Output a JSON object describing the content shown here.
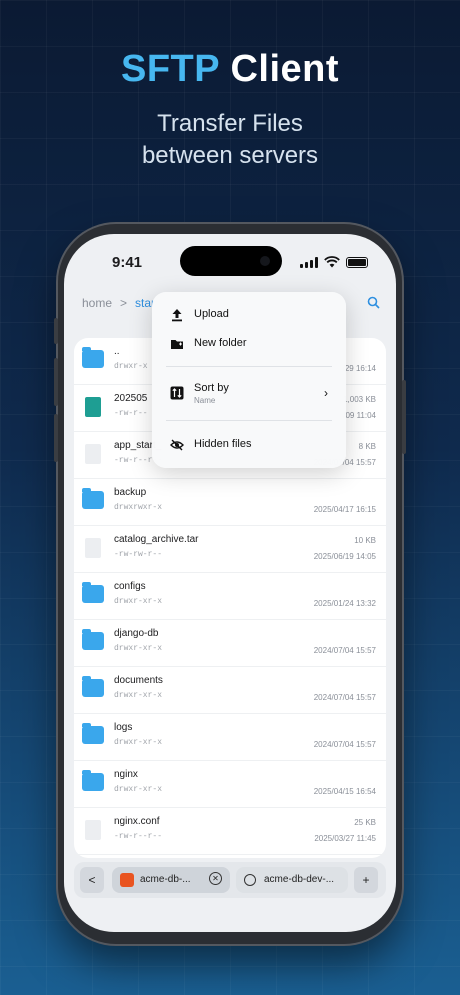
{
  "hero": {
    "title_accent": "SFTP",
    "title_rest": "Client",
    "subtitle_line1": "Transfer Files",
    "subtitle_line2": "between servers"
  },
  "status_bar": {
    "time": "9:41"
  },
  "breadcrumb": {
    "home": "home",
    "sep": ">",
    "current": "star"
  },
  "menu": {
    "items": [
      {
        "label": "Upload",
        "icon": "upload-icon"
      },
      {
        "label": "New folder",
        "icon": "new-folder-icon"
      },
      {
        "label": "Sort by",
        "sub": "Name",
        "icon": "sort-icon"
      },
      {
        "label": "Hidden files",
        "icon": "eye-off-icon"
      }
    ]
  },
  "files": [
    {
      "name": "..",
      "perm": "drwxr-x",
      "size": "",
      "date": "/29 16:14",
      "type": "folder"
    },
    {
      "name": "202505",
      "perm": "-rw-r--",
      "size": "1,003 KB",
      "date": "/09 11:04",
      "type": "image"
    },
    {
      "name": "app_start_",
      "perm": "-rw-r--r--",
      "size": "8 KB",
      "date": "2024/07/04 15:57",
      "type": "file"
    },
    {
      "name": "backup",
      "perm": "drwxrwxr-x",
      "size": "",
      "date": "2025/04/17 16:15",
      "type": "folder"
    },
    {
      "name": "catalog_archive.tar",
      "perm": "-rw-rw-r--",
      "size": "10 KB",
      "date": "2025/06/19 14:05",
      "type": "file"
    },
    {
      "name": "configs",
      "perm": "drwxr-xr-x",
      "size": "",
      "date": "2025/01/24 13:32",
      "type": "folder"
    },
    {
      "name": "django-db",
      "perm": "drwxr-xr-x",
      "size": "",
      "date": "2024/07/04 15:57",
      "type": "folder"
    },
    {
      "name": "documents",
      "perm": "drwxr-xr-x",
      "size": "",
      "date": "2024/07/04 15:57",
      "type": "folder"
    },
    {
      "name": "logs",
      "perm": "drwxr-xr-x",
      "size": "",
      "date": "2024/07/04 15:57",
      "type": "folder"
    },
    {
      "name": "nginx",
      "perm": "drwxr-xr-x",
      "size": "",
      "date": "2025/04/15 16:54",
      "type": "folder"
    },
    {
      "name": "nginx.conf",
      "perm": "-rw-r--r--",
      "size": "25 KB",
      "date": "2025/03/27 11:45",
      "type": "file"
    }
  ],
  "tabbar": {
    "back": "<",
    "tab1": "acme-db-...",
    "tab2": "acme-db-dev-...",
    "add": "+"
  },
  "colors": {
    "accent": "#47b7f0",
    "folder": "#3aa7ec",
    "link": "#2e8fe0"
  }
}
